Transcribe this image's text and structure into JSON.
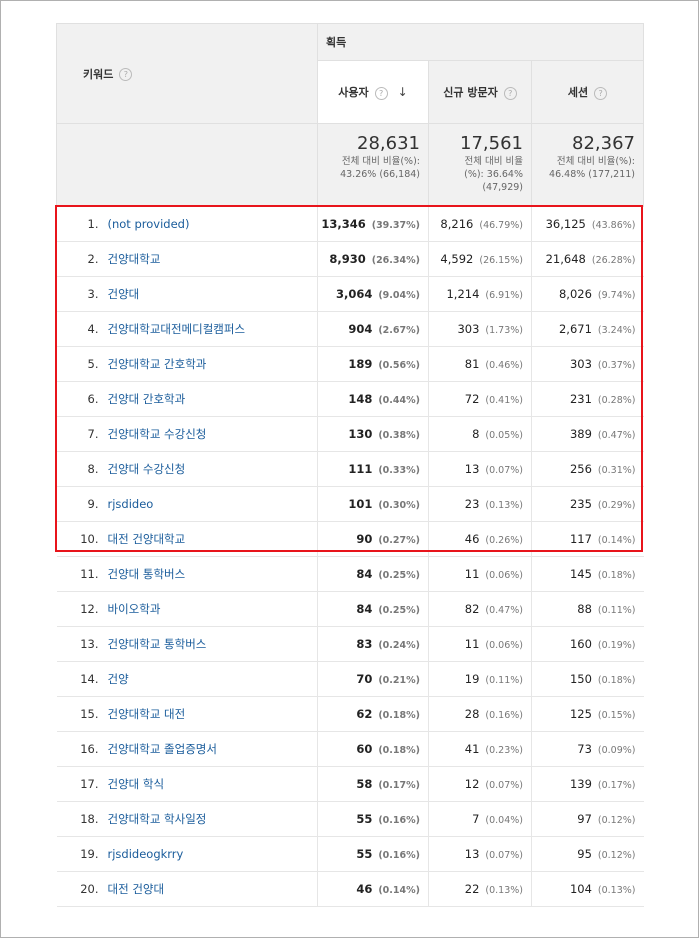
{
  "header": {
    "keyword_col": "키워드",
    "group": "획득",
    "metrics": [
      "사용자",
      "신규 방문자",
      "세션"
    ]
  },
  "totals": [
    {
      "value": "28,631",
      "line1": "전체 대비 비율(%):",
      "line2": "43.26% (66,184)",
      "line3": ""
    },
    {
      "value": "17,561",
      "line1": "전체 대비 비율",
      "line2": "(%): 36.64%",
      "line3": "(47,929)"
    },
    {
      "value": "82,367",
      "line1": "전체 대비 비율(%):",
      "line2": "46.48% (177,211)",
      "line3": ""
    }
  ],
  "rows": [
    {
      "idx": "1.",
      "kw": "(not provided)",
      "u": "13,346",
      "up": "(39.37%)",
      "n": "8,216",
      "np": "(46.79%)",
      "s": "36,125",
      "sp": "(43.86%)"
    },
    {
      "idx": "2.",
      "kw": "건양대학교",
      "u": "8,930",
      "up": "(26.34%)",
      "n": "4,592",
      "np": "(26.15%)",
      "s": "21,648",
      "sp": "(26.28%)"
    },
    {
      "idx": "3.",
      "kw": "건양대",
      "u": "3,064",
      "up": "(9.04%)",
      "n": "1,214",
      "np": "(6.91%)",
      "s": "8,026",
      "sp": "(9.74%)"
    },
    {
      "idx": "4.",
      "kw": "건양대학교대전메디컬캠퍼스",
      "u": "904",
      "up": "(2.67%)",
      "n": "303",
      "np": "(1.73%)",
      "s": "2,671",
      "sp": "(3.24%)"
    },
    {
      "idx": "5.",
      "kw": "건양대학교 간호학과",
      "u": "189",
      "up": "(0.56%)",
      "n": "81",
      "np": "(0.46%)",
      "s": "303",
      "sp": "(0.37%)"
    },
    {
      "idx": "6.",
      "kw": "건양대 간호학과",
      "u": "148",
      "up": "(0.44%)",
      "n": "72",
      "np": "(0.41%)",
      "s": "231",
      "sp": "(0.28%)"
    },
    {
      "idx": "7.",
      "kw": "건양대학교 수강신청",
      "u": "130",
      "up": "(0.38%)",
      "n": "8",
      "np": "(0.05%)",
      "s": "389",
      "sp": "(0.47%)"
    },
    {
      "idx": "8.",
      "kw": "건양대 수강신청",
      "u": "111",
      "up": "(0.33%)",
      "n": "13",
      "np": "(0.07%)",
      "s": "256",
      "sp": "(0.31%)"
    },
    {
      "idx": "9.",
      "kw": "rjsdideo",
      "u": "101",
      "up": "(0.30%)",
      "n": "23",
      "np": "(0.13%)",
      "s": "235",
      "sp": "(0.29%)"
    },
    {
      "idx": "10.",
      "kw": "대전 건양대학교",
      "u": "90",
      "up": "(0.27%)",
      "n": "46",
      "np": "(0.26%)",
      "s": "117",
      "sp": "(0.14%)"
    },
    {
      "idx": "11.",
      "kw": "건양대 통학버스",
      "u": "84",
      "up": "(0.25%)",
      "n": "11",
      "np": "(0.06%)",
      "s": "145",
      "sp": "(0.18%)"
    },
    {
      "idx": "12.",
      "kw": "바이오학과",
      "u": "84",
      "up": "(0.25%)",
      "n": "82",
      "np": "(0.47%)",
      "s": "88",
      "sp": "(0.11%)"
    },
    {
      "idx": "13.",
      "kw": "건양대학교 통학버스",
      "u": "83",
      "up": "(0.24%)",
      "n": "11",
      "np": "(0.06%)",
      "s": "160",
      "sp": "(0.19%)"
    },
    {
      "idx": "14.",
      "kw": "건양",
      "u": "70",
      "up": "(0.21%)",
      "n": "19",
      "np": "(0.11%)",
      "s": "150",
      "sp": "(0.18%)"
    },
    {
      "idx": "15.",
      "kw": "건양대학교 대전",
      "u": "62",
      "up": "(0.18%)",
      "n": "28",
      "np": "(0.16%)",
      "s": "125",
      "sp": "(0.15%)"
    },
    {
      "idx": "16.",
      "kw": "건양대학교 졸업증명서",
      "u": "60",
      "up": "(0.18%)",
      "n": "41",
      "np": "(0.23%)",
      "s": "73",
      "sp": "(0.09%)"
    },
    {
      "idx": "17.",
      "kw": "건양대 학식",
      "u": "58",
      "up": "(0.17%)",
      "n": "12",
      "np": "(0.07%)",
      "s": "139",
      "sp": "(0.17%)"
    },
    {
      "idx": "18.",
      "kw": "건양대학교 학사일정",
      "u": "55",
      "up": "(0.16%)",
      "n": "7",
      "np": "(0.04%)",
      "s": "97",
      "sp": "(0.12%)"
    },
    {
      "idx": "19.",
      "kw": "rjsdideogkrry",
      "u": "55",
      "up": "(0.16%)",
      "n": "13",
      "np": "(0.07%)",
      "s": "95",
      "sp": "(0.12%)"
    },
    {
      "idx": "20.",
      "kw": "대전 건양대",
      "u": "46",
      "up": "(0.14%)",
      "n": "22",
      "np": "(0.13%)",
      "s": "104",
      "sp": "(0.13%)"
    }
  ],
  "colors": {
    "highlight": "#e8141b",
    "link": "#1a5c9b"
  }
}
